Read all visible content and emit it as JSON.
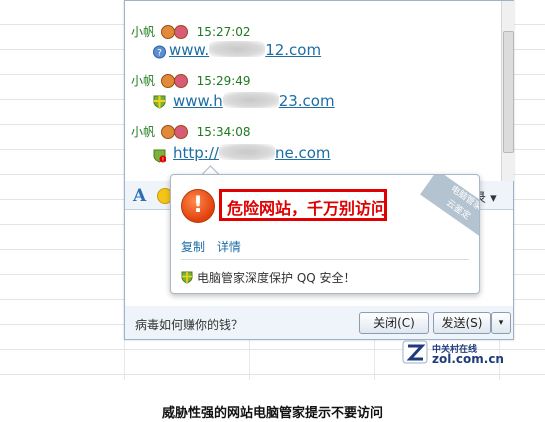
{
  "chat": {
    "messages": [
      {
        "sender": "小帆",
        "time": "15:27:02",
        "link_prefix": "www.",
        "link_suffix": "12.com"
      },
      {
        "sender": "小帆",
        "time": "15:29:49",
        "link_prefix": "www.h",
        "link_suffix": "23.com"
      },
      {
        "sender": "小帆",
        "time": "15:34:08",
        "link_prefix": "http://",
        "link_suffix": "ne.com"
      }
    ]
  },
  "toolbar": {
    "font_label": "A",
    "record_label": "录 ▾"
  },
  "popup": {
    "warning_text": "危险网站，千万别访问",
    "stamp_line1": "电脑管家",
    "stamp_line2": "云鉴定",
    "copy_link": "复制",
    "details_link": "详情",
    "footer_text": "电脑管家深度保护 QQ 安全！"
  },
  "bottom": {
    "tip_text": "病毒如何赚你的钱？",
    "close_label": "关闭(C)",
    "send_label": "发送(S)",
    "send_arrow": "▾"
  },
  "watermark": {
    "cn": "中关村在线",
    "en": "zol.com.cn"
  },
  "caption": "威胁性强的网站电脑管家提示不要访问",
  "colors": {
    "danger": "#e00000",
    "link": "#1c6ea4",
    "sender": "#1f7a1f"
  },
  "icons": [
    "security-shield-icon",
    "question-shield-icon",
    "warning-shield-icon",
    "exclamation-warning-icon",
    "zol-logo-icon"
  ]
}
